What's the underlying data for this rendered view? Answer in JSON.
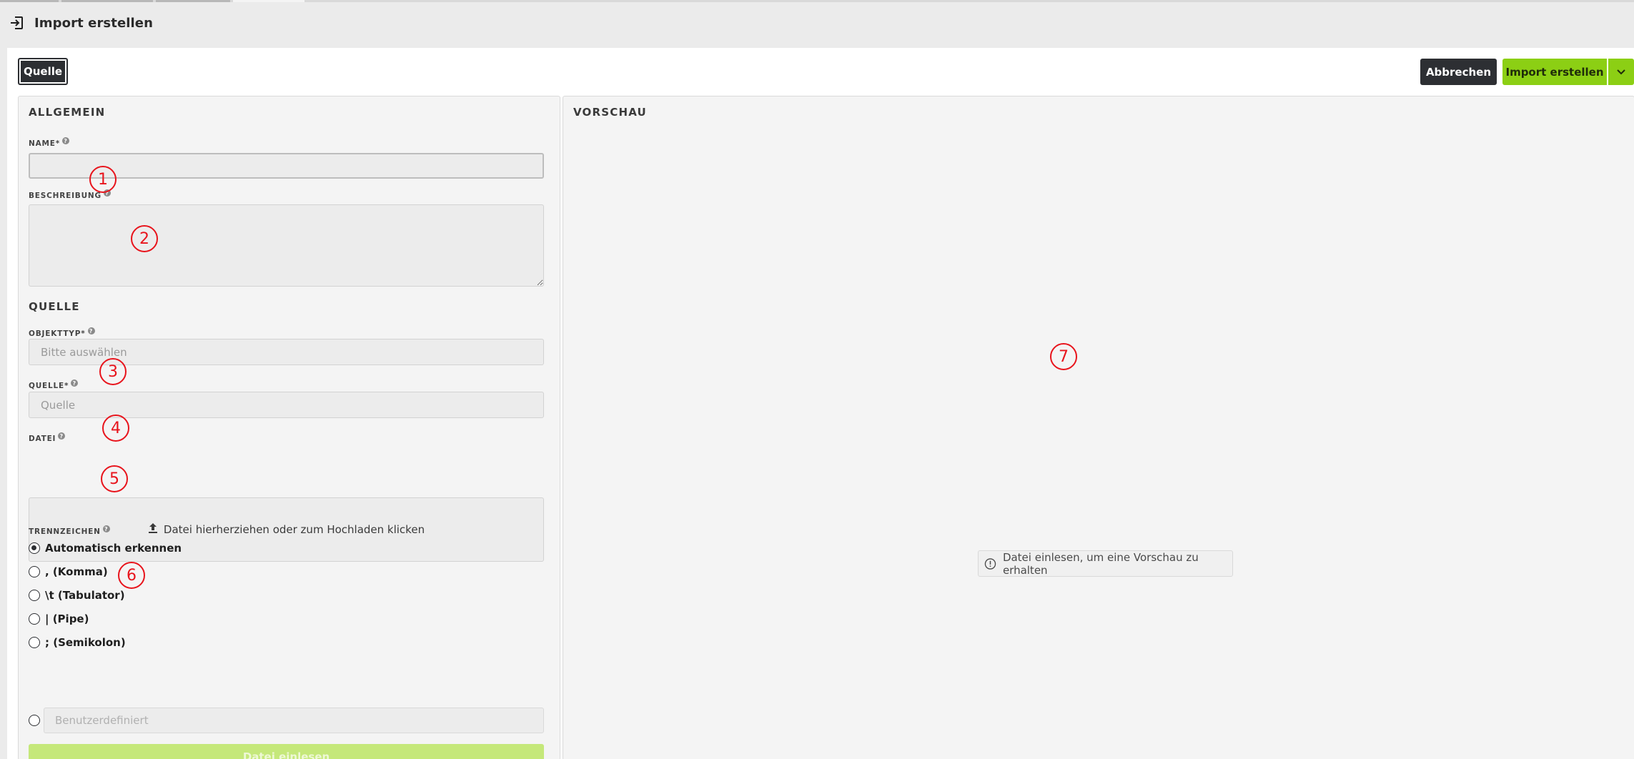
{
  "header": {
    "title": "Import erstellen",
    "icon": "import-icon"
  },
  "toolbar": {
    "tab_quelle": "Quelle",
    "cancel_label": "Abbrechen",
    "create_label": "Import erstellen"
  },
  "allgemein": {
    "section_title": "ALLGEMEIN",
    "name_label": "NAME*",
    "name_value": "",
    "description_label": "BESCHREIBUNG",
    "description_value": ""
  },
  "quelle": {
    "section_title": "QUELLE",
    "objekttyp_label": "OBJEKTTYP*",
    "objekttyp_placeholder": "Bitte auswählen",
    "quelle_label": "QUELLE*",
    "quelle_placeholder": "Quelle",
    "datei_label": "DATEI",
    "dropzone_text": "Datei hierherziehen oder zum Hochladen klicken",
    "trennzeichen_label": "TRENNZEICHEN",
    "options": [
      {
        "label": "Automatisch erkennen",
        "checked": true
      },
      {
        "label": ", (Komma)",
        "checked": false
      },
      {
        "label": "\\t (Tabulator)",
        "checked": false
      },
      {
        "label": "| (Pipe)",
        "checked": false
      },
      {
        "label": "; (Semikolon)",
        "checked": false
      }
    ],
    "custom_placeholder": "Benutzerdefiniert",
    "read_button": "Datei einlesen"
  },
  "vorschau": {
    "section_title": "VORSCHAU",
    "hint": "Datei einlesen, um eine Vorschau zu erhalten"
  },
  "markers": [
    "1",
    "2",
    "3",
    "4",
    "5",
    "6",
    "7"
  ],
  "colors": {
    "accent_green": "#8ccf14",
    "dark_button": "#2d2f33",
    "marker_red": "#e8141c"
  }
}
